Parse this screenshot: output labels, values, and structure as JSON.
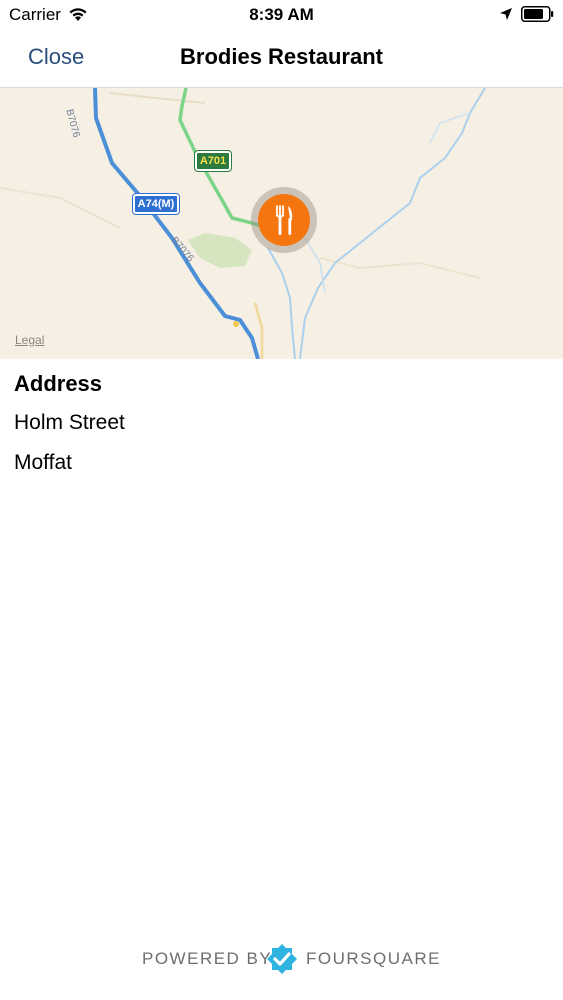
{
  "status_bar": {
    "carrier": "Carrier",
    "time": "8:39 AM",
    "icons": [
      "wifi-icon",
      "location-arrow-icon",
      "battery-icon"
    ]
  },
  "nav": {
    "close_label": "Close",
    "title": "Brodies Restaurant"
  },
  "map": {
    "legal_label": "Legal",
    "road_labels": {
      "b7076_top": "B7076",
      "b7076_mid": "B7076",
      "a74m": "A74(M)",
      "a701": "A701"
    },
    "pin_icon": "fork-knife-icon",
    "colors": {
      "pin": "#f5760f",
      "motorway": "#4a8fd8",
      "a_road": "#6bcf7a",
      "water": "#9ec7e8",
      "land": "#f6efe3"
    }
  },
  "address": {
    "heading": "Address",
    "line1": "Holm Street",
    "line2": "Moffat"
  },
  "footer": {
    "powered_by": "POWERED BY",
    "brand": "FOURSQUARE",
    "logo_icon": "foursquare-logo-icon"
  }
}
